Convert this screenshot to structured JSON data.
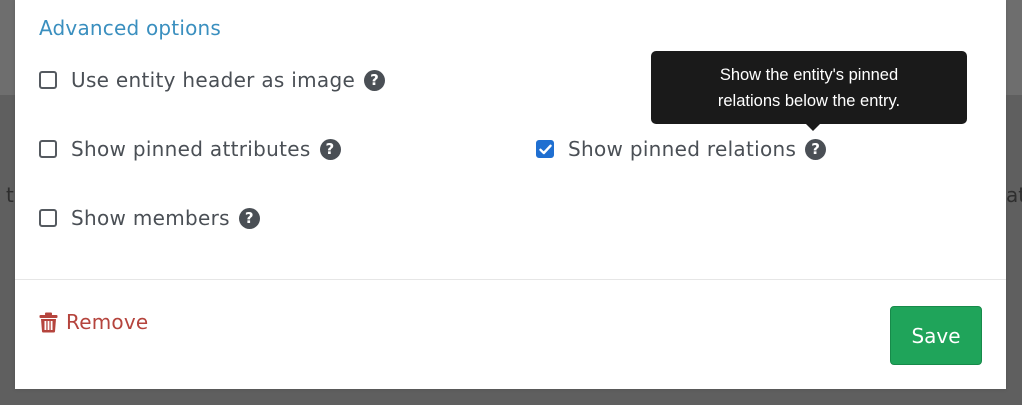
{
  "background": {
    "left_fragment": "t",
    "right_fragment": "at"
  },
  "section": {
    "title": "Advanced options"
  },
  "options": [
    {
      "label": "Use entity header as image",
      "checked": false
    },
    {
      "label": "Show pinned attributes",
      "checked": false
    },
    {
      "label": "Show pinned relations",
      "checked": true
    },
    {
      "label": "Show members",
      "checked": false
    }
  ],
  "help_icon_glyph": "?",
  "tooltip": {
    "line1": "Show the entity's pinned",
    "line2": "relations below the entry."
  },
  "footer": {
    "remove_label": "Remove",
    "save_label": "Save"
  },
  "colors": {
    "accent": "#3a8fbf",
    "danger": "#b5443d",
    "success": "#1fa45a",
    "checkbox_checked": "#1f6fd1"
  },
  "icons": {
    "help": "question-circle-icon",
    "trash": "trash-icon",
    "check": "checkmark-icon"
  }
}
